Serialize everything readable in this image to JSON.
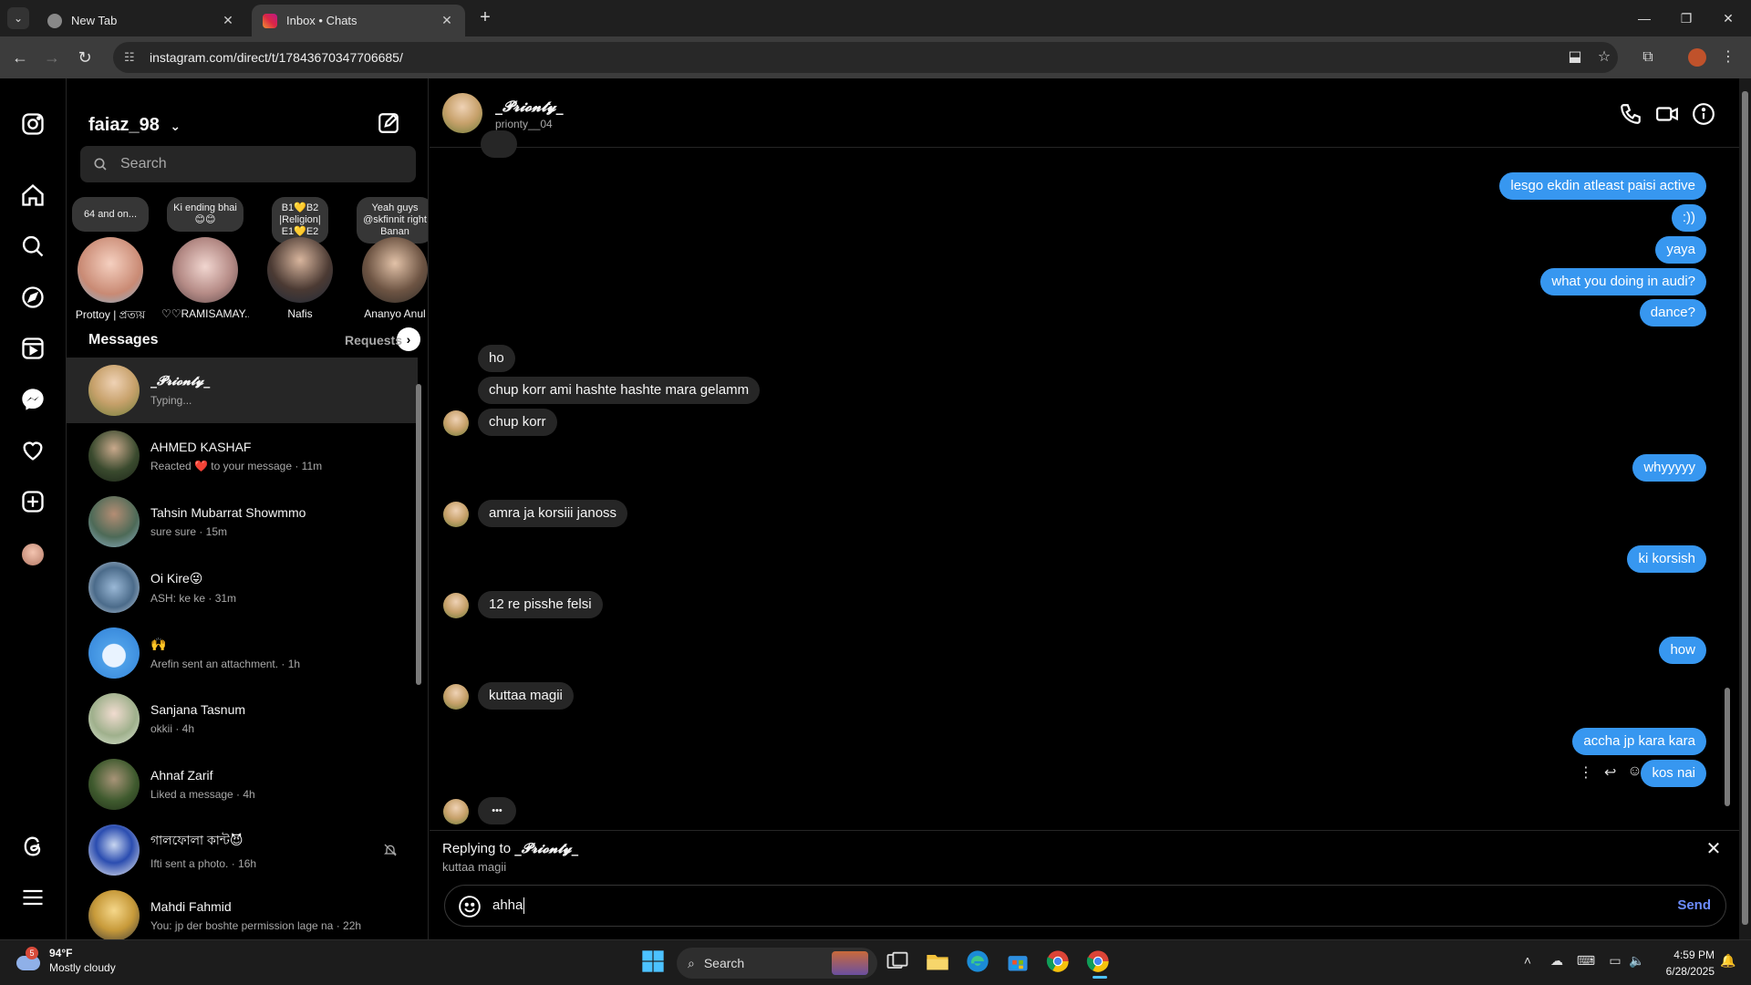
{
  "browser": {
    "tabs": [
      {
        "title": "New Tab"
      },
      {
        "title": "Inbox • Chats"
      }
    ],
    "url": "instagram.com/direct/t/17843670347706685/",
    "accent": "#3797f0"
  },
  "inbox": {
    "username": "faiaz_98",
    "search_placeholder": "Search",
    "notes": [
      {
        "note": "64 and on...",
        "name": "Prottoy | প্রত্যয়"
      },
      {
        "note": "Ki ending bhai 😊😊",
        "name": "♡♡RAMISAMAY..."
      },
      {
        "note": "B1💛B2 |Religion| E1💛E2",
        "name": "Nafis"
      },
      {
        "note": "Yeah guys @skfinnit right Banan",
        "name": "Ananyo Anul"
      }
    ],
    "messages_heading": "Messages",
    "requests_label": "Requests",
    "conversations": [
      {
        "name": "_𝓟𝓻𝓲𝓸𝓷𝓽𝔂_",
        "preview": "Typing..."
      },
      {
        "name": "AHMED KASHAF",
        "preview": "Reacted ❤️ to your message · 11m"
      },
      {
        "name": "Tahsin Mubarrat Showmmo",
        "preview": "sure sure · 15m"
      },
      {
        "name": "Oi Kire😜",
        "preview": "ASH: ke ke · 31m"
      },
      {
        "name": "🙌",
        "preview": "Arefin sent an attachment. · 1h"
      },
      {
        "name": "Sanjana Tasnum",
        "preview": "okkii · 4h"
      },
      {
        "name": "Ahnaf Zarif",
        "preview": "Liked a message · 4h"
      },
      {
        "name": "গালফোলা কান্ট😈",
        "preview": "Ifti sent a photo. · 16h"
      },
      {
        "name": "Mahdi Fahmid",
        "preview": "You: jp der boshte permission lage na · 22h"
      }
    ]
  },
  "chat": {
    "name": "_𝓟𝓻𝓲𝓸𝓷𝓽𝔂_",
    "handle": "prionty__04",
    "messages": [
      {
        "dir": "out",
        "text": "lesgo ekdin atleast paisi active"
      },
      {
        "dir": "out",
        "text": ":))"
      },
      {
        "dir": "out",
        "text": "yaya"
      },
      {
        "dir": "out",
        "text": "what you doing in audi?"
      },
      {
        "dir": "out",
        "text": "dance?"
      },
      {
        "dir": "in",
        "text": "ho"
      },
      {
        "dir": "in",
        "text": "chup korr ami hashte hashte mara gelamm"
      },
      {
        "dir": "in",
        "text": "chup korr"
      },
      {
        "dir": "out",
        "text": "whyyyyy"
      },
      {
        "dir": "in",
        "text": "amra ja korsiii janoss"
      },
      {
        "dir": "out",
        "text": "ki korsish"
      },
      {
        "dir": "in",
        "text": "12 re pisshe felsi"
      },
      {
        "dir": "out",
        "text": "how"
      },
      {
        "dir": "in",
        "text": "kuttaa magii"
      },
      {
        "dir": "out",
        "text": "accha jp kara kara"
      },
      {
        "dir": "out",
        "text": "kos nai"
      }
    ],
    "typing_indicator": "•••",
    "reply": {
      "label": "Replying to",
      "to": "_𝓟𝓻𝓲𝓸𝓷𝓽𝔂_",
      "quote": "kuttaa magii"
    },
    "composer": {
      "value": "ahha",
      "send_label": "Send"
    }
  },
  "taskbar": {
    "weather_temp": "94°F",
    "weather_desc": "Mostly cloudy",
    "weather_badge": "5",
    "search_label": "Search",
    "time": "4:59 PM",
    "date": "6/28/2025"
  }
}
